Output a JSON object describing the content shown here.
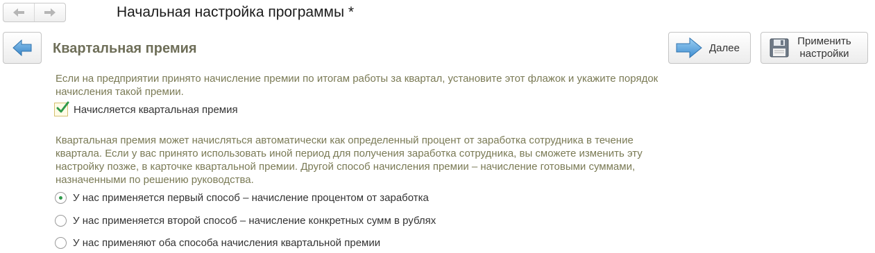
{
  "window": {
    "title": "Начальная настройка программы *"
  },
  "nav": {
    "back_icon": "arrow-left-icon",
    "forward_icon": "arrow-right-icon"
  },
  "section": {
    "title": "Квартальная премия",
    "back_icon": "big-back-arrow-icon"
  },
  "toolbar": {
    "next_label": "Далее",
    "next_icon": "arrow-right-icon",
    "apply_label_line1": "Применить",
    "apply_label_line2": "настройки",
    "apply_icon": "floppy-disk-icon"
  },
  "content": {
    "intro_text": "Если на предприятии принято начисление премии по итогам работы за квартал, установите этот флажок и укажите порядок начисления такой премии.",
    "checkbox": {
      "label": "Начисляется квартальная премия",
      "checked": true
    },
    "method_text": "Квартальная премия может начисляться автоматически как определенный процент от заработка сотрудника в течение квартала. Если у вас принято использовать иной период для получения заработка сотрудника, вы сможете изменить эту настройку позже, в карточке квартальной премии. Другой способ начисления премии – начисление готовыми суммами, назначенными по решению руководства.",
    "radio_options": [
      {
        "label": "У нас применяется первый способ – начисление процентом от заработка",
        "selected": true
      },
      {
        "label": "У нас применяется второй способ – начисление конкретных сумм в рублях",
        "selected": false
      },
      {
        "label": "У нас применяют оба способа начисления квартальной премии",
        "selected": false
      }
    ]
  },
  "colors": {
    "accent_blue": "#4a9ad8",
    "title_olive": "#6e6e58",
    "desc_olive": "#7a7a55",
    "check_green": "#2f9a4a"
  }
}
